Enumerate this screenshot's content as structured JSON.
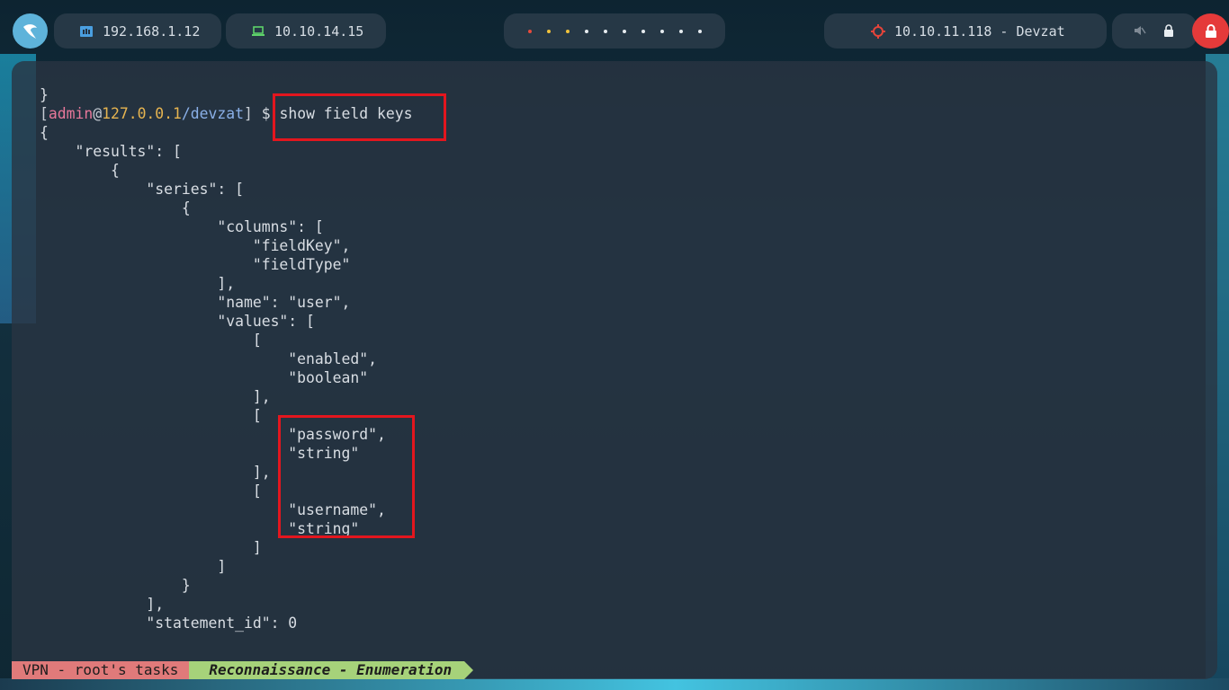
{
  "topbar": {
    "host_ip": "192.168.1.12",
    "vpn_ip": "10.10.14.15",
    "workspace_dot_colors": [
      "#e64a3c",
      "#f0c23c",
      "#f0c23c",
      "#e6ebef",
      "#e6ebef",
      "#e6ebef",
      "#e6ebef",
      "#e6ebef",
      "#e6ebef",
      "#e6ebef"
    ],
    "target": "10.10.11.118 - Devzat"
  },
  "terminal": {
    "prompt": {
      "open": "[",
      "user": "admin",
      "at": "@",
      "host": "127.0.0.1",
      "path": "/devzat",
      "close": "]",
      "dollar": " $ "
    },
    "command": "show field keys",
    "lines": [
      "}",
      "",
      "{",
      "    \"results\": [",
      "        {",
      "            \"series\": [",
      "                {",
      "                    \"columns\": [",
      "                        \"fieldKey\",",
      "                        \"fieldType\"",
      "                    ],",
      "                    \"name\": \"user\",",
      "                    \"values\": [",
      "                        [",
      "                            \"enabled\",",
      "                            \"boolean\"",
      "                        ],",
      "                        [",
      "                            \"password\",",
      "                            \"string\"",
      "                        ],",
      "                        [",
      "                            \"username\",",
      "                            \"string\"",
      "                        ]",
      "                    ]",
      "                }",
      "            ],",
      "            \"statement_id\": 0"
    ]
  },
  "statusbar": {
    "session": "VPN - root's tasks",
    "window": "Reconnaissance - Enumeration"
  }
}
